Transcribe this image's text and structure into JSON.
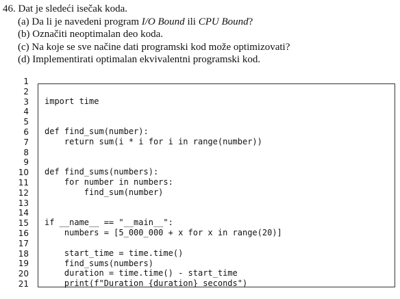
{
  "question": {
    "number": "46.",
    "text": "Dat je sledeći isečak koda.",
    "items": [
      {
        "label": "(a)",
        "pre": "Da li je navedeni program ",
        "em1": "I/O Bound",
        "mid": " ili ",
        "em2": "CPU Bound",
        "post": "?"
      },
      {
        "label": "(b)",
        "text": "Označiti neoptimalan deo koda."
      },
      {
        "label": "(c)",
        "text": "Na koje se sve načine dati programski kod može optimizovati?"
      },
      {
        "label": "(d)",
        "text": "Implementirati optimalan ekvivalentni programski kod."
      }
    ]
  },
  "code": {
    "line_numbers": [
      "1",
      "2",
      "3",
      "4",
      "5",
      "6",
      "7",
      "8",
      "9",
      "10",
      "11",
      "12",
      "13",
      "14",
      "15",
      "16",
      "17",
      "18",
      "19",
      "20",
      "21"
    ],
    "lines": [
      "",
      "import time",
      "",
      "",
      "def find_sum(number):",
      "    return sum(i * i for i in range(number))",
      "",
      "",
      "def find_sums(numbers):",
      "    for number in numbers:",
      "        find_sum(number)",
      "",
      "",
      "if __name__ == \"__main__\":",
      "    numbers = [5_000_000 + x for x in range(20)]",
      "",
      "    start_time = time.time()",
      "    find_sums(numbers)",
      "    duration = time.time() - start_time",
      "    print(f\"Duration {duration} seconds\")",
      ""
    ]
  }
}
